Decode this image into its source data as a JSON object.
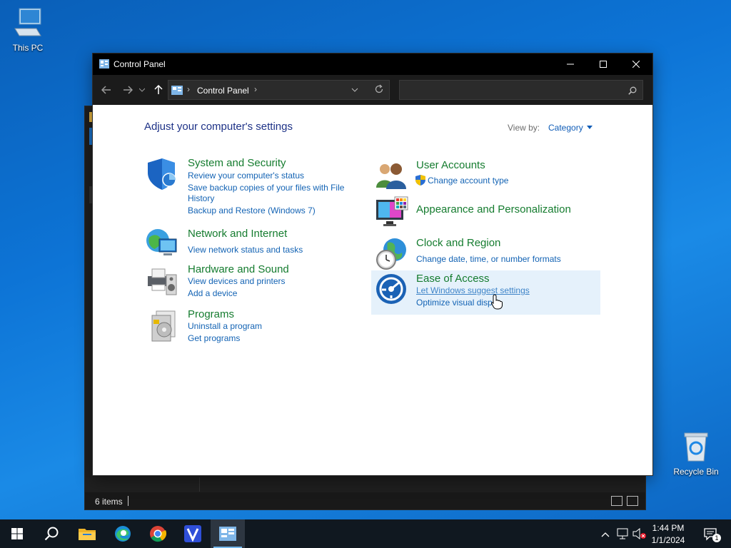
{
  "desktop": {
    "this_pc_label": "This PC",
    "recycle_bin_label": "Recycle Bin"
  },
  "background_window": {
    "status_count": "6 items"
  },
  "window": {
    "title": "Control Panel",
    "address_crumb": "Control Panel",
    "search_placeholder": "",
    "heading": "Adjust your computer's settings",
    "view_by_label": "View by:",
    "view_by_value": "Category"
  },
  "categories": [
    {
      "title": "System and Security",
      "icon": "shield-icon",
      "links": [
        "Review your computer's status",
        "Save backup copies of your files with File",
        "History",
        "Backup and Restore (Windows 7)"
      ]
    },
    {
      "title": "Network and Internet",
      "icon": "network-icon",
      "links": [
        "View network status and tasks"
      ]
    },
    {
      "title": "Hardware and Sound",
      "icon": "printer-icon",
      "links": [
        "View devices and printers",
        "Add a device"
      ]
    },
    {
      "title": "Programs",
      "icon": "programs-icon",
      "links": [
        "Uninstall a program",
        "Get programs"
      ]
    },
    {
      "title": "User Accounts",
      "icon": "users-icon",
      "links": [
        "Change account type"
      ]
    },
    {
      "title": "Appearance and Personalization",
      "icon": "monitor-icon",
      "links": []
    },
    {
      "title": "Clock and Region",
      "icon": "clock-globe-icon",
      "links": [
        "Change date, time, or number formats"
      ]
    },
    {
      "title": "Ease of Access",
      "icon": "ease-of-access-icon",
      "links": [
        "Let Windows suggest settings",
        "Optimize visual disp"
      ]
    }
  ],
  "taskbar": {
    "time": "1:44 PM",
    "date": "1/1/2024",
    "notification_count": "1"
  },
  "colors": {
    "category_title": "#157c2f",
    "link": "#1363b4",
    "heading": "#1e3287",
    "hover_highlight": "#e5f1fb"
  }
}
